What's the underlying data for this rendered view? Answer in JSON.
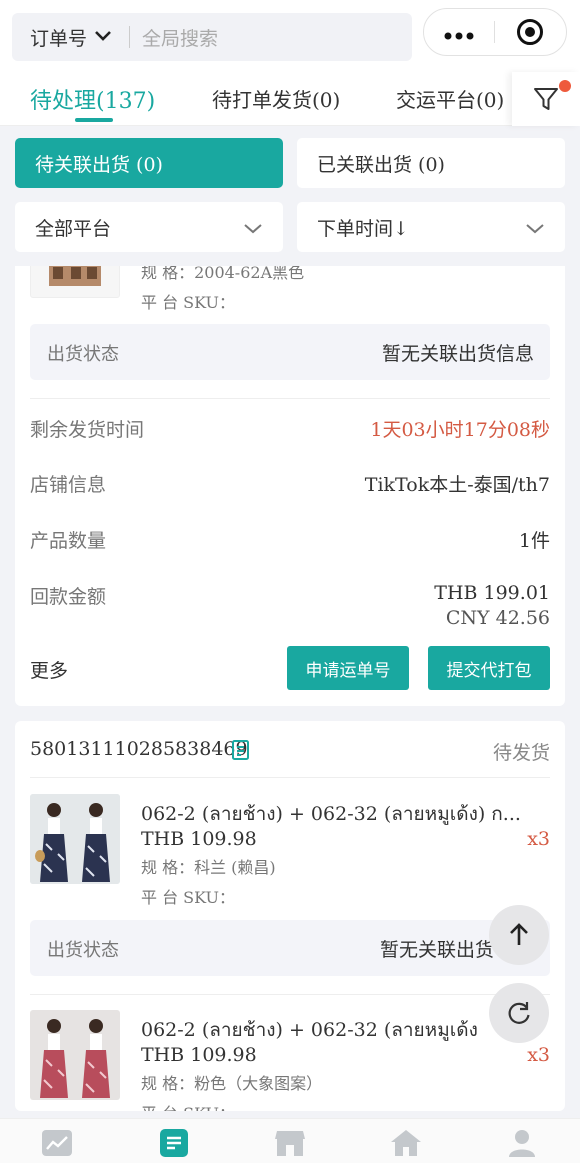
{
  "search": {
    "selector_label": "订单号",
    "placeholder": "全局搜索"
  },
  "capsule": {
    "more_icon": "more-dots-icon",
    "close_icon": "target-icon"
  },
  "tabs": [
    {
      "label": "待处理(137)",
      "active": true
    },
    {
      "label": "待打单发货(0)"
    },
    {
      "label": "交运平台(0)"
    }
  ],
  "segments": [
    {
      "label": "待关联出货 (0)",
      "active": true
    },
    {
      "label": "已关联出货 (0)"
    }
  ],
  "dropdowns": [
    {
      "label": "全部平台"
    },
    {
      "label": "下单时间↓"
    }
  ],
  "card1": {
    "spec_partial": "规      格：2004-62A黑色",
    "platform_sku_label": "平 台 SKU：",
    "ship_status_label": "出货状态",
    "ship_status_value": "暂无关联出货信息",
    "remaining_label": "剩余发货时间",
    "remaining_value": "1天03小时17分08秒",
    "shop_label": "店铺信息",
    "shop_value": "TikTok本土-泰国/th7",
    "qty_label": "产品数量",
    "qty_value": "1件",
    "refund_label": "回款金额",
    "refund_thb": "THB 199.01",
    "refund_cny": "CNY 42.56",
    "more_label": "更多",
    "apply_waybill_btn": "申请运单号",
    "submit_pack_btn": "提交代打包"
  },
  "card2": {
    "order_no": "580131110285838469",
    "status": "待发货",
    "items": [
      {
        "title": "062-2 (ลายช้าง) + 062-32 (ลายหมูเด้ง) ก...",
        "price": "THB 109.98",
        "qty": "x3",
        "spec": "规      格：科兰 (赖昌)",
        "platform_sku": "平 台 SKU："
      },
      {
        "title": "062-2 (ลายช้าง) + 062-32 (ลายหมูเด้ง",
        "price": "THB 109.98",
        "qty": "x3",
        "spec": "规      格：粉色（大象图案）",
        "platform_sku": "平 台 SKU："
      }
    ],
    "ship_status_label": "出货状态",
    "ship_status_value": "暂无关联出货"
  },
  "colors": {
    "accent": "#19a8a0",
    "countdown": "#d45a43",
    "background": "#f2f3f7"
  },
  "bottom_nav": [
    "chart-icon",
    "orders-icon",
    "store-icon",
    "home-icon",
    "user-icon"
  ]
}
